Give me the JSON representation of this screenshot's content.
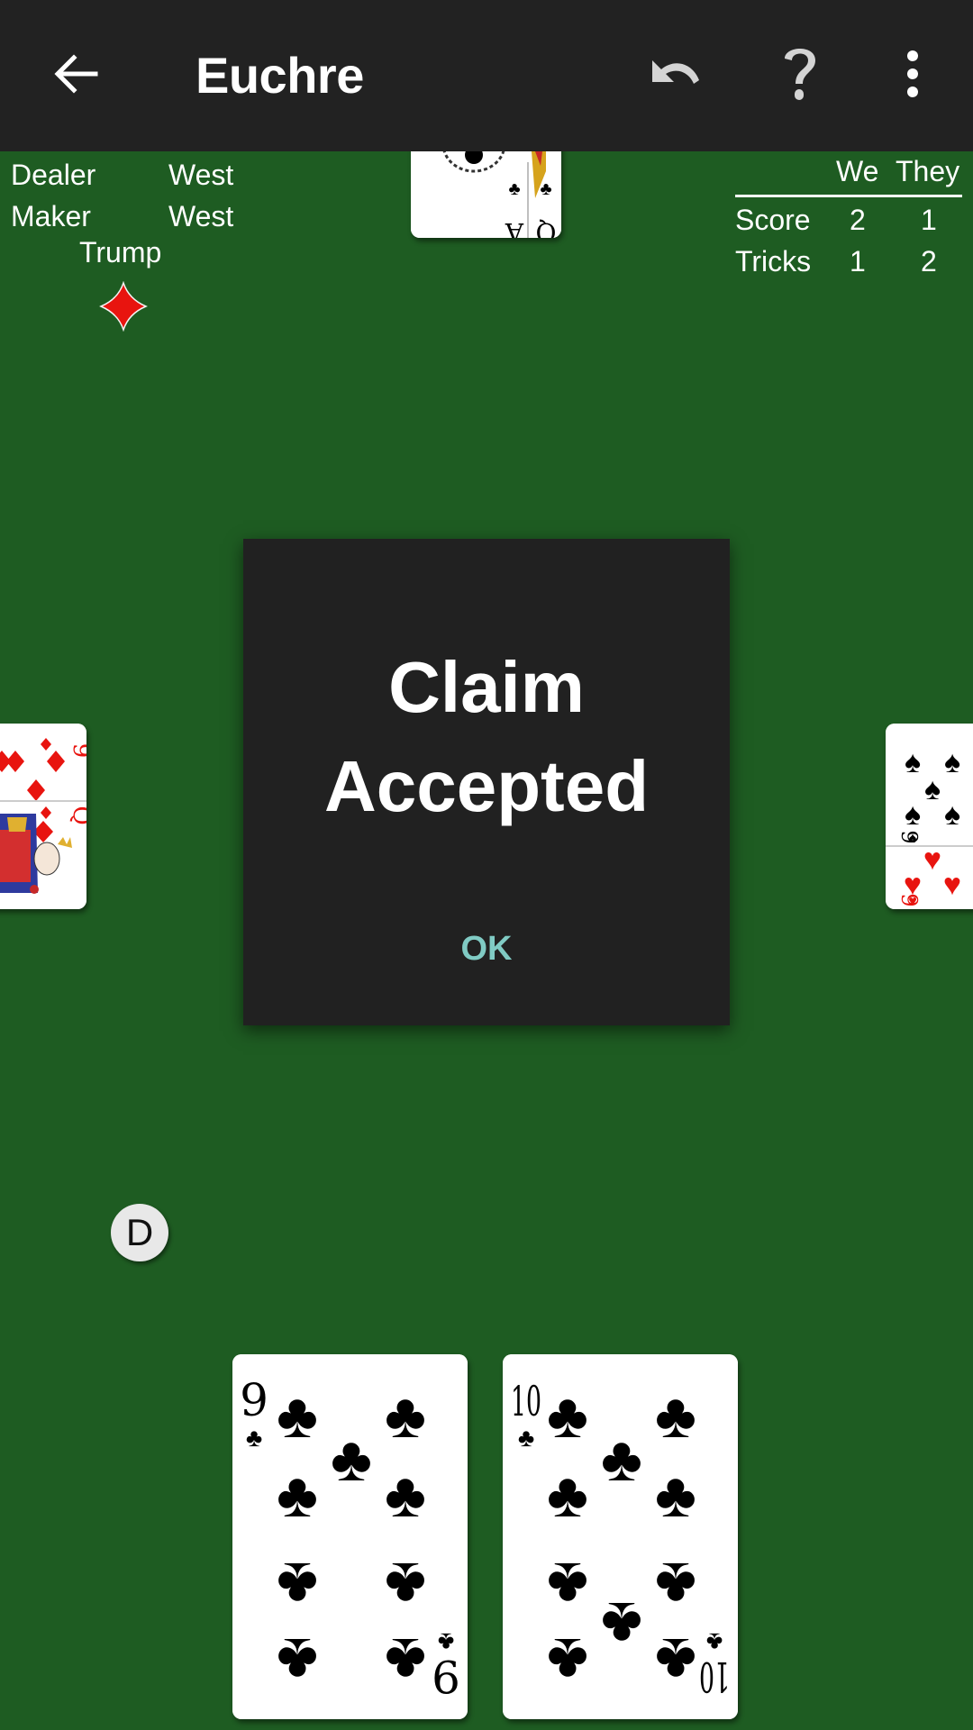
{
  "app": {
    "title": "Euchre",
    "icons": {
      "back": "arrow-left-icon",
      "undo": "undo-icon",
      "help": "help-icon",
      "more": "more-vert-icon"
    }
  },
  "info": {
    "dealer_label": "Dealer",
    "dealer_value": "West",
    "maker_label": "Maker",
    "maker_value": "West",
    "trump_label": "Trump",
    "trump_suit": "diamonds",
    "trump_color": "#e8140f"
  },
  "scoreboard": {
    "columns": [
      "We",
      "They"
    ],
    "rows": [
      {
        "label": "Score",
        "we": "2",
        "they": "1"
      },
      {
        "label": "Tricks",
        "we": "1",
        "they": "2"
      }
    ]
  },
  "table": {
    "felt_color": "#1e5c22",
    "north": [
      {
        "rank": "A",
        "suit": "clubs",
        "face_up": true,
        "orientation": "upside-down"
      },
      {
        "rank": "Q",
        "suit": "clubs",
        "face_up": true,
        "orientation": "upside-down"
      }
    ],
    "west": [
      {
        "rank": "9",
        "suit": "diamonds",
        "orientation": "rotated"
      },
      {
        "rank": "Q",
        "suit": "diamonds",
        "orientation": "rotated"
      }
    ],
    "east": [
      {
        "rank": "9",
        "suit": "spades",
        "orientation": "rotated"
      },
      {
        "rank": "9",
        "suit": "hearts",
        "orientation": "rotated"
      }
    ],
    "south_hand": [
      {
        "rank": "9",
        "suit": "clubs"
      },
      {
        "rank": "10",
        "suit": "clubs"
      }
    ],
    "dealer_marker": "D"
  },
  "dialog": {
    "line1": "Claim",
    "line2": "Accepted",
    "ok_label": "OK",
    "ok_color": "#80cbc4"
  }
}
